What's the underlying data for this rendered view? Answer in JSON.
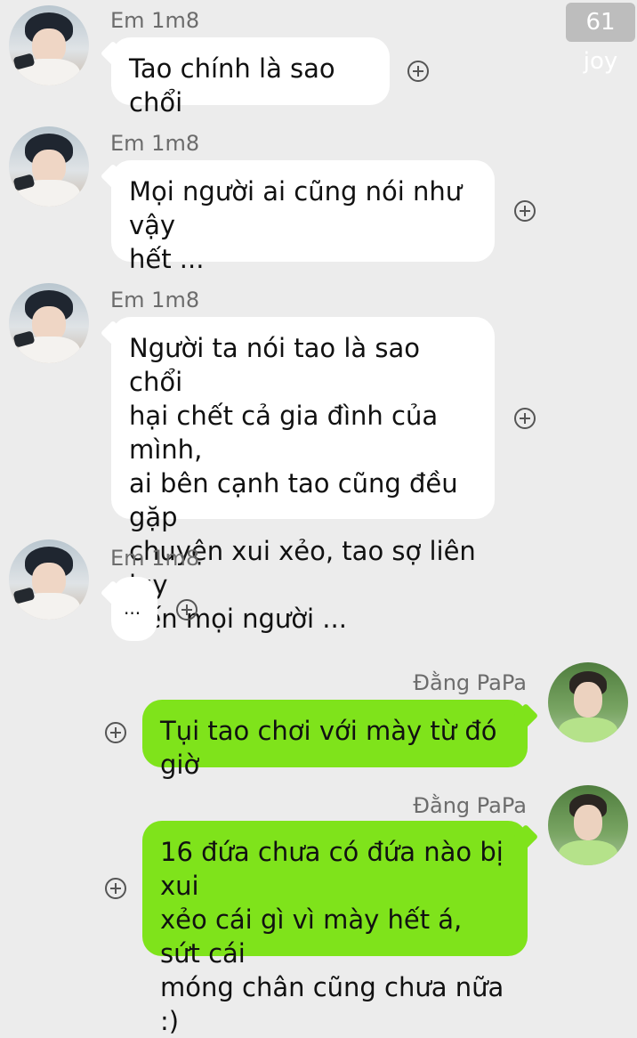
{
  "watermark": "61 joy",
  "messages": [
    {
      "sender": "Em 1m8",
      "lines": [
        "Tao chính là sao chổi"
      ]
    },
    {
      "sender": "Em 1m8",
      "lines": [
        "Mọi người ai cũng nói như vậy",
        "hết ..."
      ]
    },
    {
      "sender": "Em 1m8",
      "lines": [
        "Người ta nói tao là sao chổi",
        "hại chết cả gia đình của mình,",
        "ai bên cạnh tao cũng đều gặp",
        "chuyện xui xẻo, tao sợ liên lụy",
        "đến mọi người ..."
      ]
    },
    {
      "sender": "Em 1m8",
      "lines": [
        "..."
      ]
    },
    {
      "sender": "Đằng PaPa",
      "lines": [
        "Tụi tao chơi với mày từ đó giờ"
      ]
    },
    {
      "sender": "Đằng PaPa",
      "lines": [
        "16 đứa chưa có đứa nào bị xui",
        "xẻo cái gì vì mày hết á, sứt cái",
        "móng chân cũng chưa nữa :)"
      ]
    }
  ],
  "colors": {
    "background": "#ececec",
    "incoming": "#ffffff",
    "outgoing": "#7fe31b"
  }
}
